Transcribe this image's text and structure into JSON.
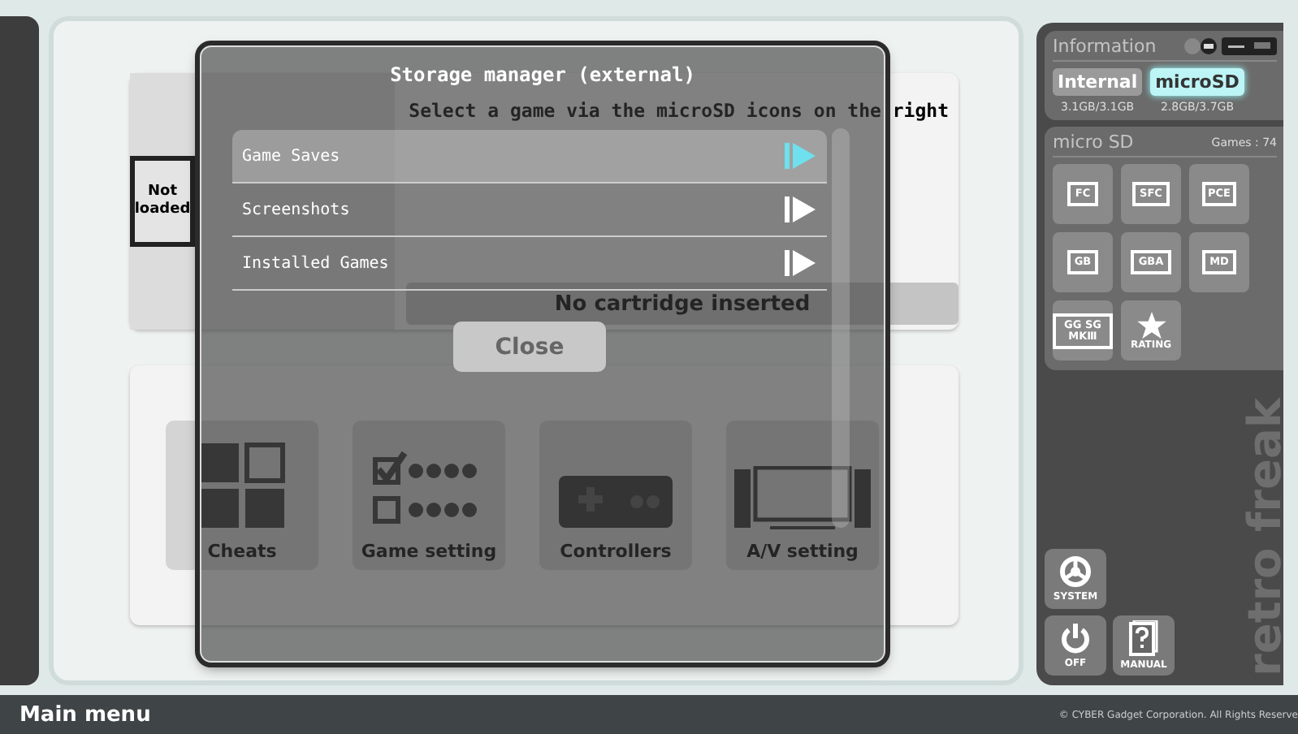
{
  "background": {
    "hint": "Select a game via the microSD icons on the right",
    "cover_text": "Not loaded",
    "cartridge_status": "No cartridge inserted",
    "tiles": [
      {
        "kind": "cheats",
        "label": "Cheats"
      },
      {
        "kind": "game_setting",
        "label": "Game setting"
      },
      {
        "kind": "controllers",
        "label": "Controllers"
      },
      {
        "kind": "av",
        "label": "A/V setting"
      }
    ]
  },
  "info_panel": {
    "title": "Information",
    "storage_tabs": [
      {
        "label": "Internal",
        "usage": "3.1GB/3.1GB",
        "selected": false
      },
      {
        "label": "microSD",
        "usage": "2.8GB/3.7GB",
        "selected": true
      }
    ],
    "section_title": "micro SD",
    "games_count": "Games : 74",
    "consoles": [
      {
        "kind": "cart",
        "label": "FC"
      },
      {
        "kind": "cart",
        "label": "SFC"
      },
      {
        "kind": "card",
        "label": "PCE"
      },
      {
        "kind": "card",
        "label": "GB"
      },
      {
        "kind": "cart",
        "label": "GBA"
      },
      {
        "kind": "cart",
        "label": "MD"
      },
      {
        "kind": "card",
        "label": "GG SG MKⅢ"
      },
      {
        "kind": "rating",
        "label": "RATING"
      }
    ],
    "system_buttons": [
      {
        "kind": "system",
        "label": "SYSTEM"
      },
      {
        "kind": "power",
        "label": "OFF"
      },
      {
        "kind": "manual",
        "label": "MANUAL"
      }
    ],
    "logo": "retro freak"
  },
  "dialog": {
    "title": "Storage manager (external)",
    "items": [
      {
        "label": "Game Saves",
        "selected": true
      },
      {
        "label": "Screenshots",
        "selected": false
      },
      {
        "label": "Installed Games",
        "selected": false
      }
    ],
    "close_button": "Close"
  },
  "footer": {
    "title": "Main menu",
    "copyright": "© CYBER Gadget Corporation. All Rights Reserve"
  }
}
